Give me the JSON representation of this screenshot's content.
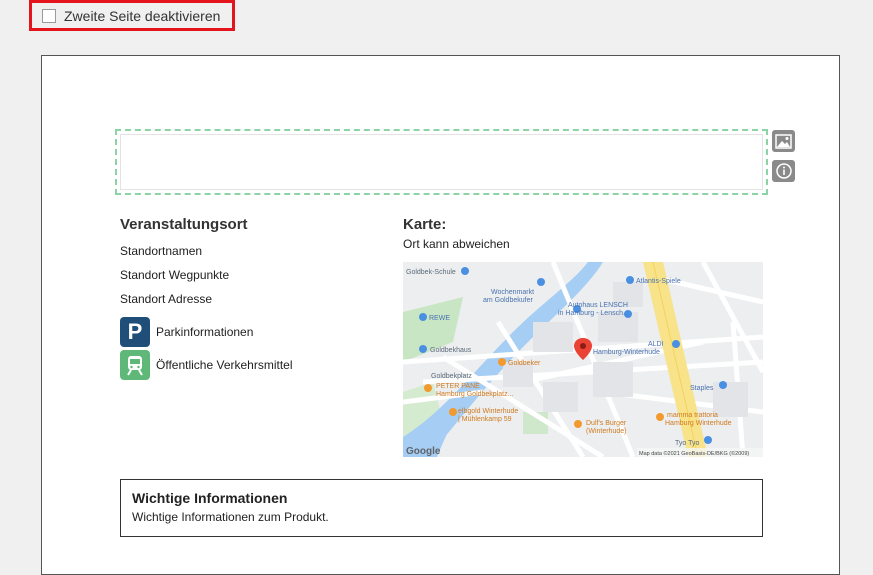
{
  "top_checkbox": {
    "label": "Zweite Seite deaktivieren",
    "checked": false
  },
  "tools": {
    "image_icon": "image-icon",
    "info_icon": "info-icon"
  },
  "venue": {
    "title": "Veranstaltungsort",
    "lines": [
      "Standortnamen",
      "Standort Wegpunkte",
      "Standort Adresse"
    ],
    "parking": {
      "label": "Parkinformationen",
      "badge": "P",
      "color": "#1f4e79"
    },
    "transit": {
      "label": "Öffentliche Verkehrsmittel",
      "color": "#5fb878"
    }
  },
  "map": {
    "title": "Karte:",
    "subtitle": "Ort kann abweichen",
    "labels": {
      "goldbek_schule": "Goldbek-Schule",
      "atlantis": "Atlantis-Spiele",
      "wochenmarkt_1": "Wochenmarkt",
      "wochenmarkt_2": "am Goldbekufer",
      "autohaus_1": "Autohaus LENSCH",
      "autohaus_2": "in Hamburg - Lensch...",
      "rewe": "REWE",
      "goldbekhaus": "Goldbekhaus",
      "goldbeker": "Goldbeker",
      "aldi_1": "ALDI",
      "aldi_2": "Hamburg-Winterhude",
      "peter_pane_1": "PETER PANE",
      "peter_pane_2": "Hamburg Goldbekplatz...",
      "goldbekplatz": "Goldbekplatz",
      "staples": "Staples",
      "elbgold_1": "elbgold Winterhude",
      "elbgold_2": "| Mühlenkamp 59",
      "dulfs_1": "Dulf's Burger",
      "dulfs_2": "(Winterhude)",
      "mamma_1": "mamma trattoria",
      "mamma_2": "Hamburg Winterhude",
      "tyo": "Tyo Tyo",
      "google": "Google",
      "attribution": "Map data ©2021 GeoBasis-DE/BKG (©2009)"
    }
  },
  "info": {
    "title": "Wichtige Informationen",
    "text": "Wichtige Informationen zum Produkt."
  }
}
